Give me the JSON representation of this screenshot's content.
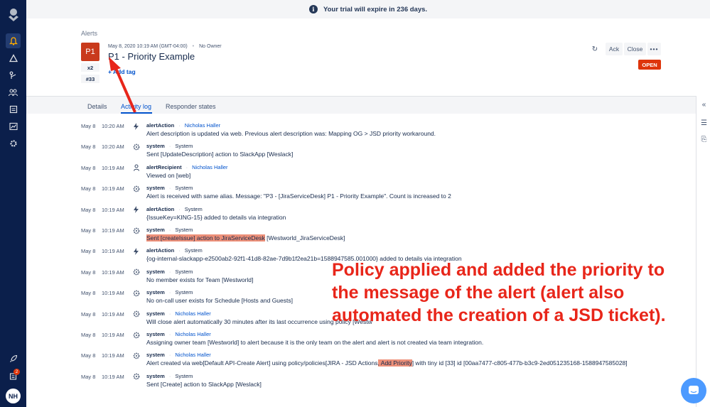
{
  "banner": {
    "text": "Your trial will expire in 236 days.",
    "icon": "info-icon"
  },
  "sidebar": {
    "items": [
      {
        "name": "opsgenie-logo-icon"
      },
      {
        "name": "alerts-bell-icon"
      },
      {
        "name": "incidents-icon"
      },
      {
        "name": "on-call-icon"
      },
      {
        "name": "teams-icon"
      },
      {
        "name": "services-icon"
      },
      {
        "name": "analytics-icon"
      },
      {
        "name": "settings-gear-icon"
      }
    ],
    "bottom": {
      "notifications_count": "2",
      "avatar_initials": "NH"
    }
  },
  "alert": {
    "breadcrumb": "Alerts",
    "priority": "P1",
    "count": "x2",
    "tiny_id": "#33",
    "datetime": "May 8, 2020 10:19 AM (GMT-04:00)",
    "owner": "No Owner",
    "title": "P1 - Priority Example",
    "add_tag": "+ Add tag",
    "actions": {
      "ack": "Ack",
      "close": "Close",
      "more": "•••"
    },
    "status": "OPEN"
  },
  "tabs": [
    "Details",
    "Activity log",
    "Responder states"
  ],
  "active_tab": "Activity log",
  "log": [
    {
      "date": "May 8",
      "time": "10:20 AM",
      "type": "alertAction",
      "actor": "Nicholas Haller",
      "actor_link": true,
      "message": "Alert description is updated via web. Previous alert description was: Mapping OG > JSD priority workaround."
    },
    {
      "date": "May 8",
      "time": "10:20 AM",
      "type": "system",
      "actor": "System",
      "actor_link": false,
      "message": "Sent [UpdateDescription] action to SlackApp [Weslack]"
    },
    {
      "date": "May 8",
      "time": "10:19 AM",
      "type": "alertRecipient",
      "actor": "Nicholas Haller",
      "actor_link": true,
      "message": "Viewed on [web]"
    },
    {
      "date": "May 8",
      "time": "10:19 AM",
      "type": "system",
      "actor": "System",
      "actor_link": false,
      "message": "Alert is received with same alias. Message: \"P3 - [JiraServiceDesk] P1 - Priority Example\". Count is increased to 2"
    },
    {
      "date": "May 8",
      "time": "10:19 AM",
      "type": "alertAction",
      "actor": "System",
      "actor_link": false,
      "message": "{IssueKey=KING-15} added to details via integration"
    },
    {
      "date": "May 8",
      "time": "10:19 AM",
      "type": "system",
      "actor": "System",
      "actor_link": false,
      "message_hl": "Sent [createIssue] action to JiraServiceDesk",
      "message_rest": " [Westworld_JiraServiceDesk]"
    },
    {
      "date": "May 8",
      "time": "10:19 AM",
      "type": "alertAction",
      "actor": "System",
      "actor_link": false,
      "message": "{og-internal-slackapp-e2500ab2-92f1-41d8-82ae-7d9b1f2ea21b=1588947585.001000} added to details via integration"
    },
    {
      "date": "May 8",
      "time": "10:19 AM",
      "type": "system",
      "actor": "System",
      "actor_link": false,
      "message": "No member exists for Team [Westworld]"
    },
    {
      "date": "May 8",
      "time": "10:19 AM",
      "type": "system",
      "actor": "System",
      "actor_link": false,
      "message": "No on-call user exists for Schedule [Hosts and Guests]"
    },
    {
      "date": "May 8",
      "time": "10:19 AM",
      "type": "system",
      "actor": "Nicholas Haller",
      "actor_link": true,
      "message": "Will close alert automatically 30 minutes after its last occurrence using policy [Westw"
    },
    {
      "date": "May 8",
      "time": "10:19 AM",
      "type": "system",
      "actor": "Nicholas Haller",
      "actor_link": true,
      "message": "Assigning owner team [Westworld] to alert because it is the only team on the alert and alert is not created via team integration."
    },
    {
      "date": "May 8",
      "time": "10:19 AM",
      "type": "system",
      "actor": "Nicholas Haller",
      "actor_link": true,
      "message_pre": "Alert created via web[Default API-Create Alert] using policy/policies[JIRA - JSD Actions",
      "message_hl": ", Add Priority",
      "message_rest": "] with tiny id [33] id [00aa7477-c805-477b-b3c9-2ed051235168-1588947585028]"
    },
    {
      "date": "May 8",
      "time": "10:19 AM",
      "type": "system",
      "actor": "System",
      "actor_link": false,
      "message": "Sent [Create] action to SlackApp [Weslack]"
    }
  ],
  "annotation": {
    "lines": [
      "Policy applied and added the priority to",
      "the message of the alert (alert also",
      "automated the creation of a JSD ticket)."
    ],
    "color": "#e8261a"
  },
  "colors": {
    "sidebar": "#0b1f4b",
    "link": "#0052cc",
    "priority": "#c93a1c",
    "open": "#de350b"
  }
}
